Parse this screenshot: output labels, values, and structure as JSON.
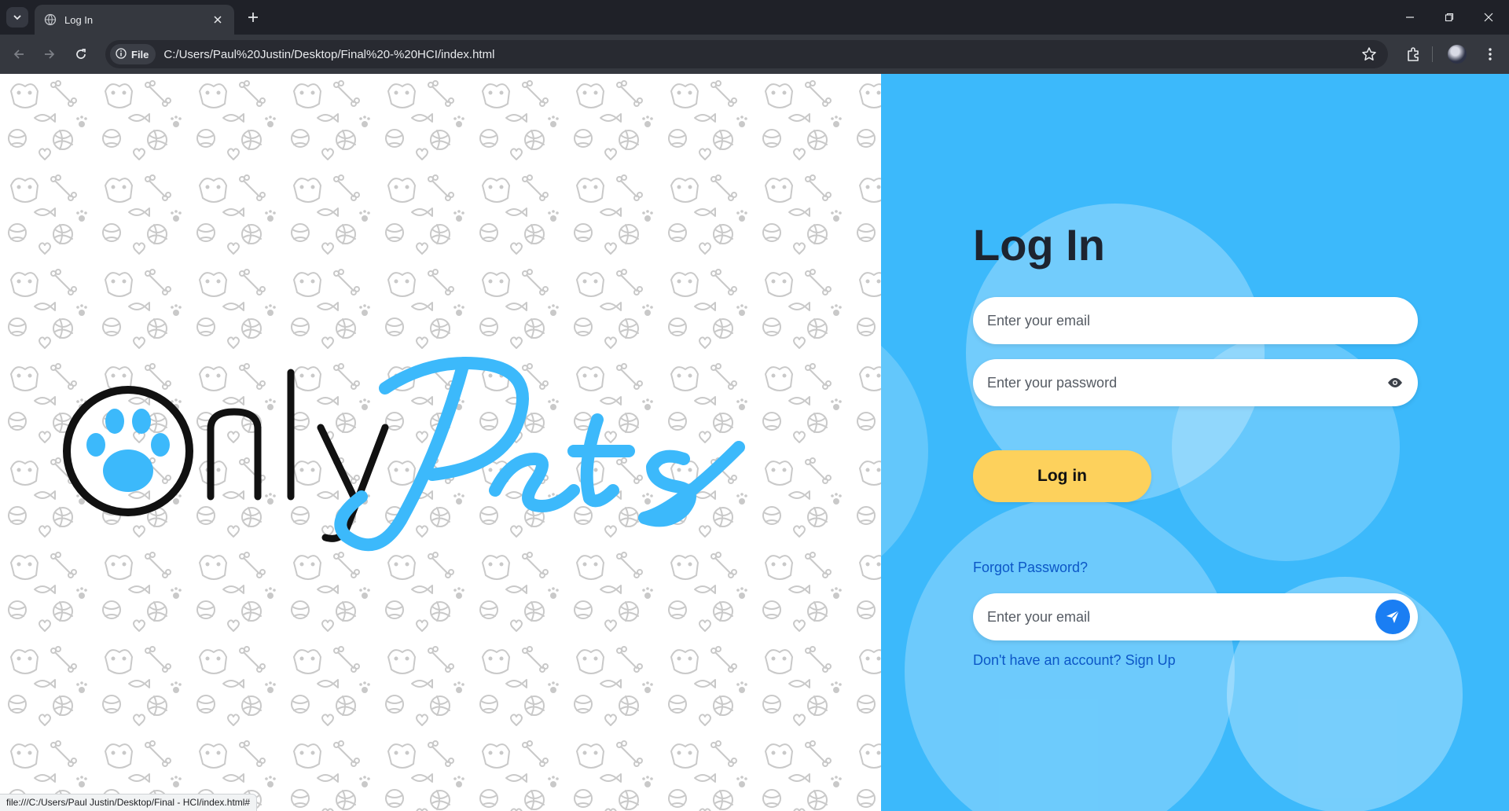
{
  "browser": {
    "tab_title": "Log In",
    "url": "C:/Users/Paul%20Justin/Desktop/Final%20-%20HCI/index.html",
    "security_chip": "File",
    "status_url": "file:///C:/Users/Paul Justin/Desktop/Final - HCI/index.html#",
    "icons": [
      "tab-search-icon",
      "globe-icon",
      "close-icon",
      "plus-icon",
      "minimize-icon",
      "restore-icon",
      "window-close-icon",
      "back-arrow-icon",
      "forward-arrow-icon",
      "reload-icon",
      "info-icon",
      "star-icon",
      "extensions-icon",
      "profile-avatar",
      "kebab-menu-icon"
    ]
  },
  "brand": {
    "logo_word_1": "Only",
    "logo_word_2": "Pets",
    "accent_color": "#3cb9fb",
    "dark_color": "#111111"
  },
  "login": {
    "title": "Log In",
    "email_placeholder": "Enter your email",
    "password_placeholder": "Enter your password",
    "login_button": "Log in",
    "button_color": "#fdd15c",
    "forgot_password": "Forgot Password?",
    "recovery_email_placeholder": "Enter your email",
    "signup_link": "Don't have an account? Sign Up",
    "link_color": "#0c57c7",
    "send_button_color": "#1a7ef3"
  }
}
